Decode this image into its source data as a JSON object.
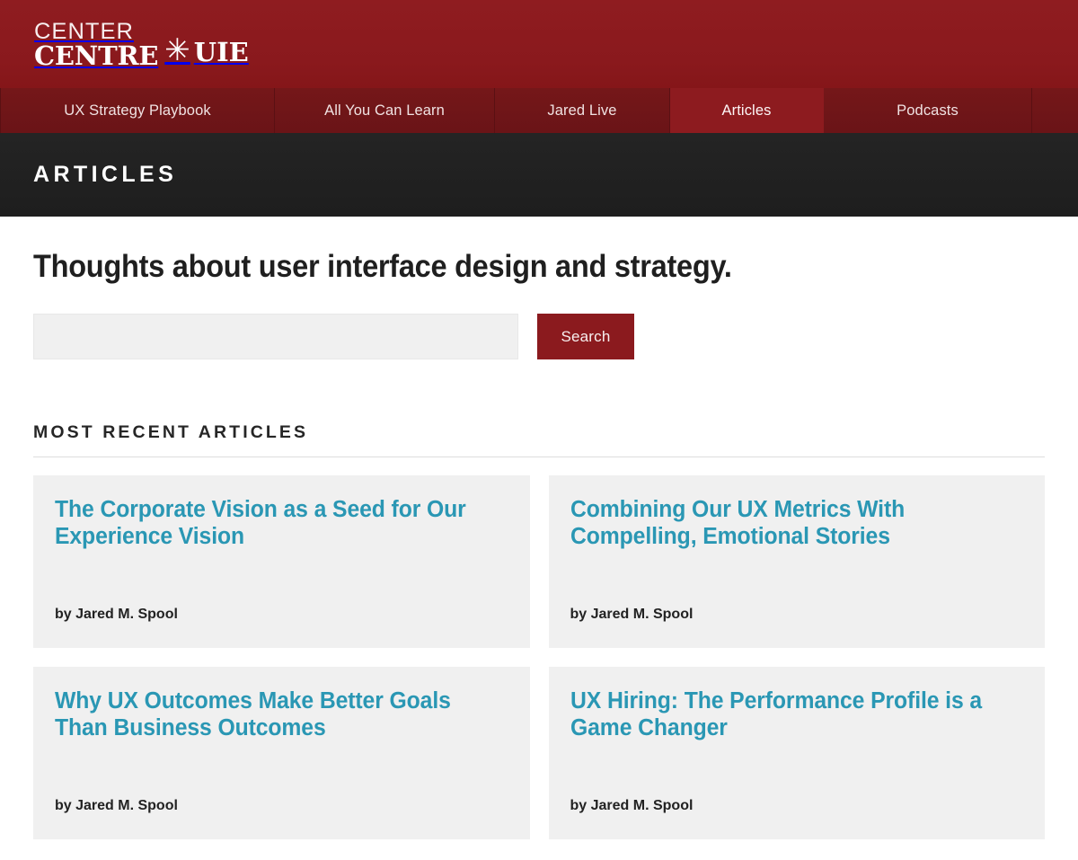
{
  "brand": {
    "logo_line1": "CENTER",
    "logo_line2": "CENTRE",
    "logo_star": "✳",
    "logo_uie": "UIE",
    "header_color": "#8b1a1e"
  },
  "nav": {
    "items": [
      {
        "label": "UX Strategy Playbook",
        "active": false
      },
      {
        "label": "All You Can Learn",
        "active": false
      },
      {
        "label": "Jared Live",
        "active": false
      },
      {
        "label": "Articles",
        "active": true
      },
      {
        "label": "Podcasts",
        "active": false
      }
    ],
    "bar_color": "#6d1518",
    "active_color": "#8d1b1f"
  },
  "banner": {
    "title": "ARTICLES",
    "background": "#212121"
  },
  "main": {
    "headline": "Thoughts about user interface design and strategy.",
    "search": {
      "value": "",
      "placeholder": "",
      "button_label": "Search"
    },
    "section_heading": "MOST RECENT ARTICLES",
    "articles": [
      {
        "title": "The Corporate Vision as a Seed for Our Experience Vision",
        "byline": "by Jared M. Spool"
      },
      {
        "title": "Combining Our UX Metrics With Compelling, Emotional Stories",
        "byline": "by Jared M. Spool"
      },
      {
        "title": "Why UX Outcomes Make Better Goals Than Business Outcomes",
        "byline": "by Jared M. Spool"
      },
      {
        "title": "UX Hiring: The Performance Profile is a Game Changer",
        "byline": "by Jared M. Spool"
      }
    ],
    "link_color": "#2a97b4",
    "card_background": "#f0f0f0"
  }
}
